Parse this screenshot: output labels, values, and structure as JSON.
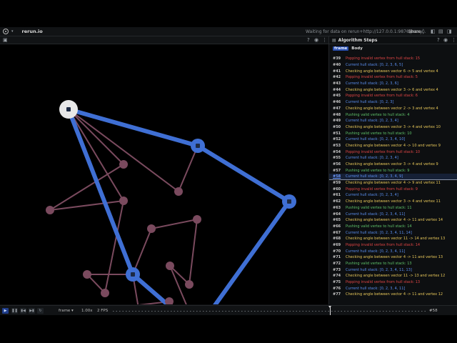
{
  "app": {
    "name": "rerun.io",
    "status": "Waiting for data on rerun+http://127.0.0.1:9876/proxy...",
    "share_label": "Share"
  },
  "panel": {
    "title": "Algorithm Steps",
    "columns": [
      "frame",
      "Body"
    ]
  },
  "steps": [
    {
      "frame": "#39",
      "text": "Popping invalid vertex from hull stack: 15",
      "color": "#e04545"
    },
    {
      "frame": "#40",
      "text": "Current hull stack: [0, 2, 3, 6, 5]",
      "color": "#5b8ff0"
    },
    {
      "frame": "#41",
      "text": "Checking angle between vector 6 -> 5 and vertex 4",
      "color": "#e8c85a"
    },
    {
      "frame": "#42",
      "text": "Popping invalid vertex from hull stack: 5",
      "color": "#e04545"
    },
    {
      "frame": "#43",
      "text": "Current hull stack: [0, 2, 3, 6]",
      "color": "#5b8ff0"
    },
    {
      "frame": "#44",
      "text": "Checking angle between vector 3 -> 6 and vertex 4",
      "color": "#e8c85a"
    },
    {
      "frame": "#45",
      "text": "Popping invalid vertex from hull stack: 6",
      "color": "#e04545"
    },
    {
      "frame": "#46",
      "text": "Current hull stack: [0, 2, 3]",
      "color": "#5b8ff0"
    },
    {
      "frame": "#47",
      "text": "Checking angle between vector 2 -> 3 and vertex 4",
      "color": "#e8c85a"
    },
    {
      "frame": "#48",
      "text": "Pushing valid vertex to hull stack: 4",
      "color": "#5fc36a"
    },
    {
      "frame": "#49",
      "text": "Current hull stack: [0, 2, 3, 4]",
      "color": "#5b8ff0"
    },
    {
      "frame": "#50",
      "text": "Checking angle between vector 3 -> 4 and vertex 10",
      "color": "#e8c85a"
    },
    {
      "frame": "#51",
      "text": "Pushing valid vertex to hull stack: 10",
      "color": "#5fc36a"
    },
    {
      "frame": "#52",
      "text": "Current hull stack: [0, 2, 3, 4, 10]",
      "color": "#5b8ff0"
    },
    {
      "frame": "#53",
      "text": "Checking angle between vector 4 -> 10 and vertex 9",
      "color": "#e8c85a"
    },
    {
      "frame": "#54",
      "text": "Popping invalid vertex from hull stack: 10",
      "color": "#e04545"
    },
    {
      "frame": "#55",
      "text": "Current hull stack: [0, 2, 3, 4]",
      "color": "#5b8ff0"
    },
    {
      "frame": "#56",
      "text": "Checking angle between vector 3 -> 4 and vertex 9",
      "color": "#e8c85a"
    },
    {
      "frame": "#57",
      "text": "Pushing valid vertex to hull stack: 9",
      "color": "#5fc36a"
    },
    {
      "frame": "#58",
      "text": "Current hull stack: [0, 2, 3, 4, 9]",
      "color": "#5b8ff0",
      "selected": true
    },
    {
      "frame": "#59",
      "text": "Checking angle between vector 4 -> 9 and vertex 11",
      "color": "#e8c85a"
    },
    {
      "frame": "#60",
      "text": "Popping invalid vertex from hull stack: 9",
      "color": "#e04545"
    },
    {
      "frame": "#61",
      "text": "Current hull stack: [0, 2, 3, 4]",
      "color": "#5b8ff0"
    },
    {
      "frame": "#62",
      "text": "Checking angle between vector 3 -> 4 and vertex 11",
      "color": "#e8c85a"
    },
    {
      "frame": "#63",
      "text": "Pushing valid vertex to hull stack: 11",
      "color": "#5fc36a"
    },
    {
      "frame": "#64",
      "text": "Current hull stack: [0, 2, 3, 4, 11]",
      "color": "#5b8ff0"
    },
    {
      "frame": "#65",
      "text": "Checking angle between vector 4 -> 11 and vertex 14",
      "color": "#e8c85a"
    },
    {
      "frame": "#66",
      "text": "Pushing valid vertex to hull stack: 14",
      "color": "#5fc36a"
    },
    {
      "frame": "#67",
      "text": "Current hull stack: [0, 2, 3, 4, 11, 14]",
      "color": "#5b8ff0"
    },
    {
      "frame": "#68",
      "text": "Checking angle between vector 11 -> 14 and vertex 13",
      "color": "#e8c85a"
    },
    {
      "frame": "#69",
      "text": "Popping invalid vertex from hull stack: 14",
      "color": "#e04545"
    },
    {
      "frame": "#70",
      "text": "Current hull stack: [0, 2, 3, 4, 11]",
      "color": "#5b8ff0"
    },
    {
      "frame": "#71",
      "text": "Checking angle between vector 4 -> 11 and vertex 13",
      "color": "#e8c85a"
    },
    {
      "frame": "#72",
      "text": "Pushing valid vertex to hull stack: 13",
      "color": "#5fc36a"
    },
    {
      "frame": "#73",
      "text": "Current hull stack: [0, 2, 3, 4, 11, 13]",
      "color": "#5b8ff0"
    },
    {
      "frame": "#74",
      "text": "Checking angle between vector 11 -> 13 and vertex 12",
      "color": "#e8c85a"
    },
    {
      "frame": "#75",
      "text": "Popping invalid vertex from hull stack: 13",
      "color": "#e04545"
    },
    {
      "frame": "#76",
      "text": "Current hull stack: [0, 2, 3, 4, 11]",
      "color": "#5b8ff0"
    },
    {
      "frame": "#77",
      "text": "Checking angle between vector 4 -> 11 and vertex 12",
      "color": "#e8c85a"
    }
  ],
  "timeline": {
    "timeline_name": "frame",
    "speed": "1.00x",
    "fps": "2 FPS",
    "current_frame": "#58",
    "position": 0.69
  },
  "colors": {
    "hull": "#3f6fd4",
    "edge": "#7a4a5e",
    "point": "#7a4a5e",
    "hull_point": "#3f6fd4",
    "start_point": "#e8e8e8"
  },
  "icons": {
    "logo": "rerun-logo-icon",
    "menu": "chevron-down-icon",
    "help": "help-icon",
    "visibility": "eye-icon",
    "more": "more-icon"
  }
}
